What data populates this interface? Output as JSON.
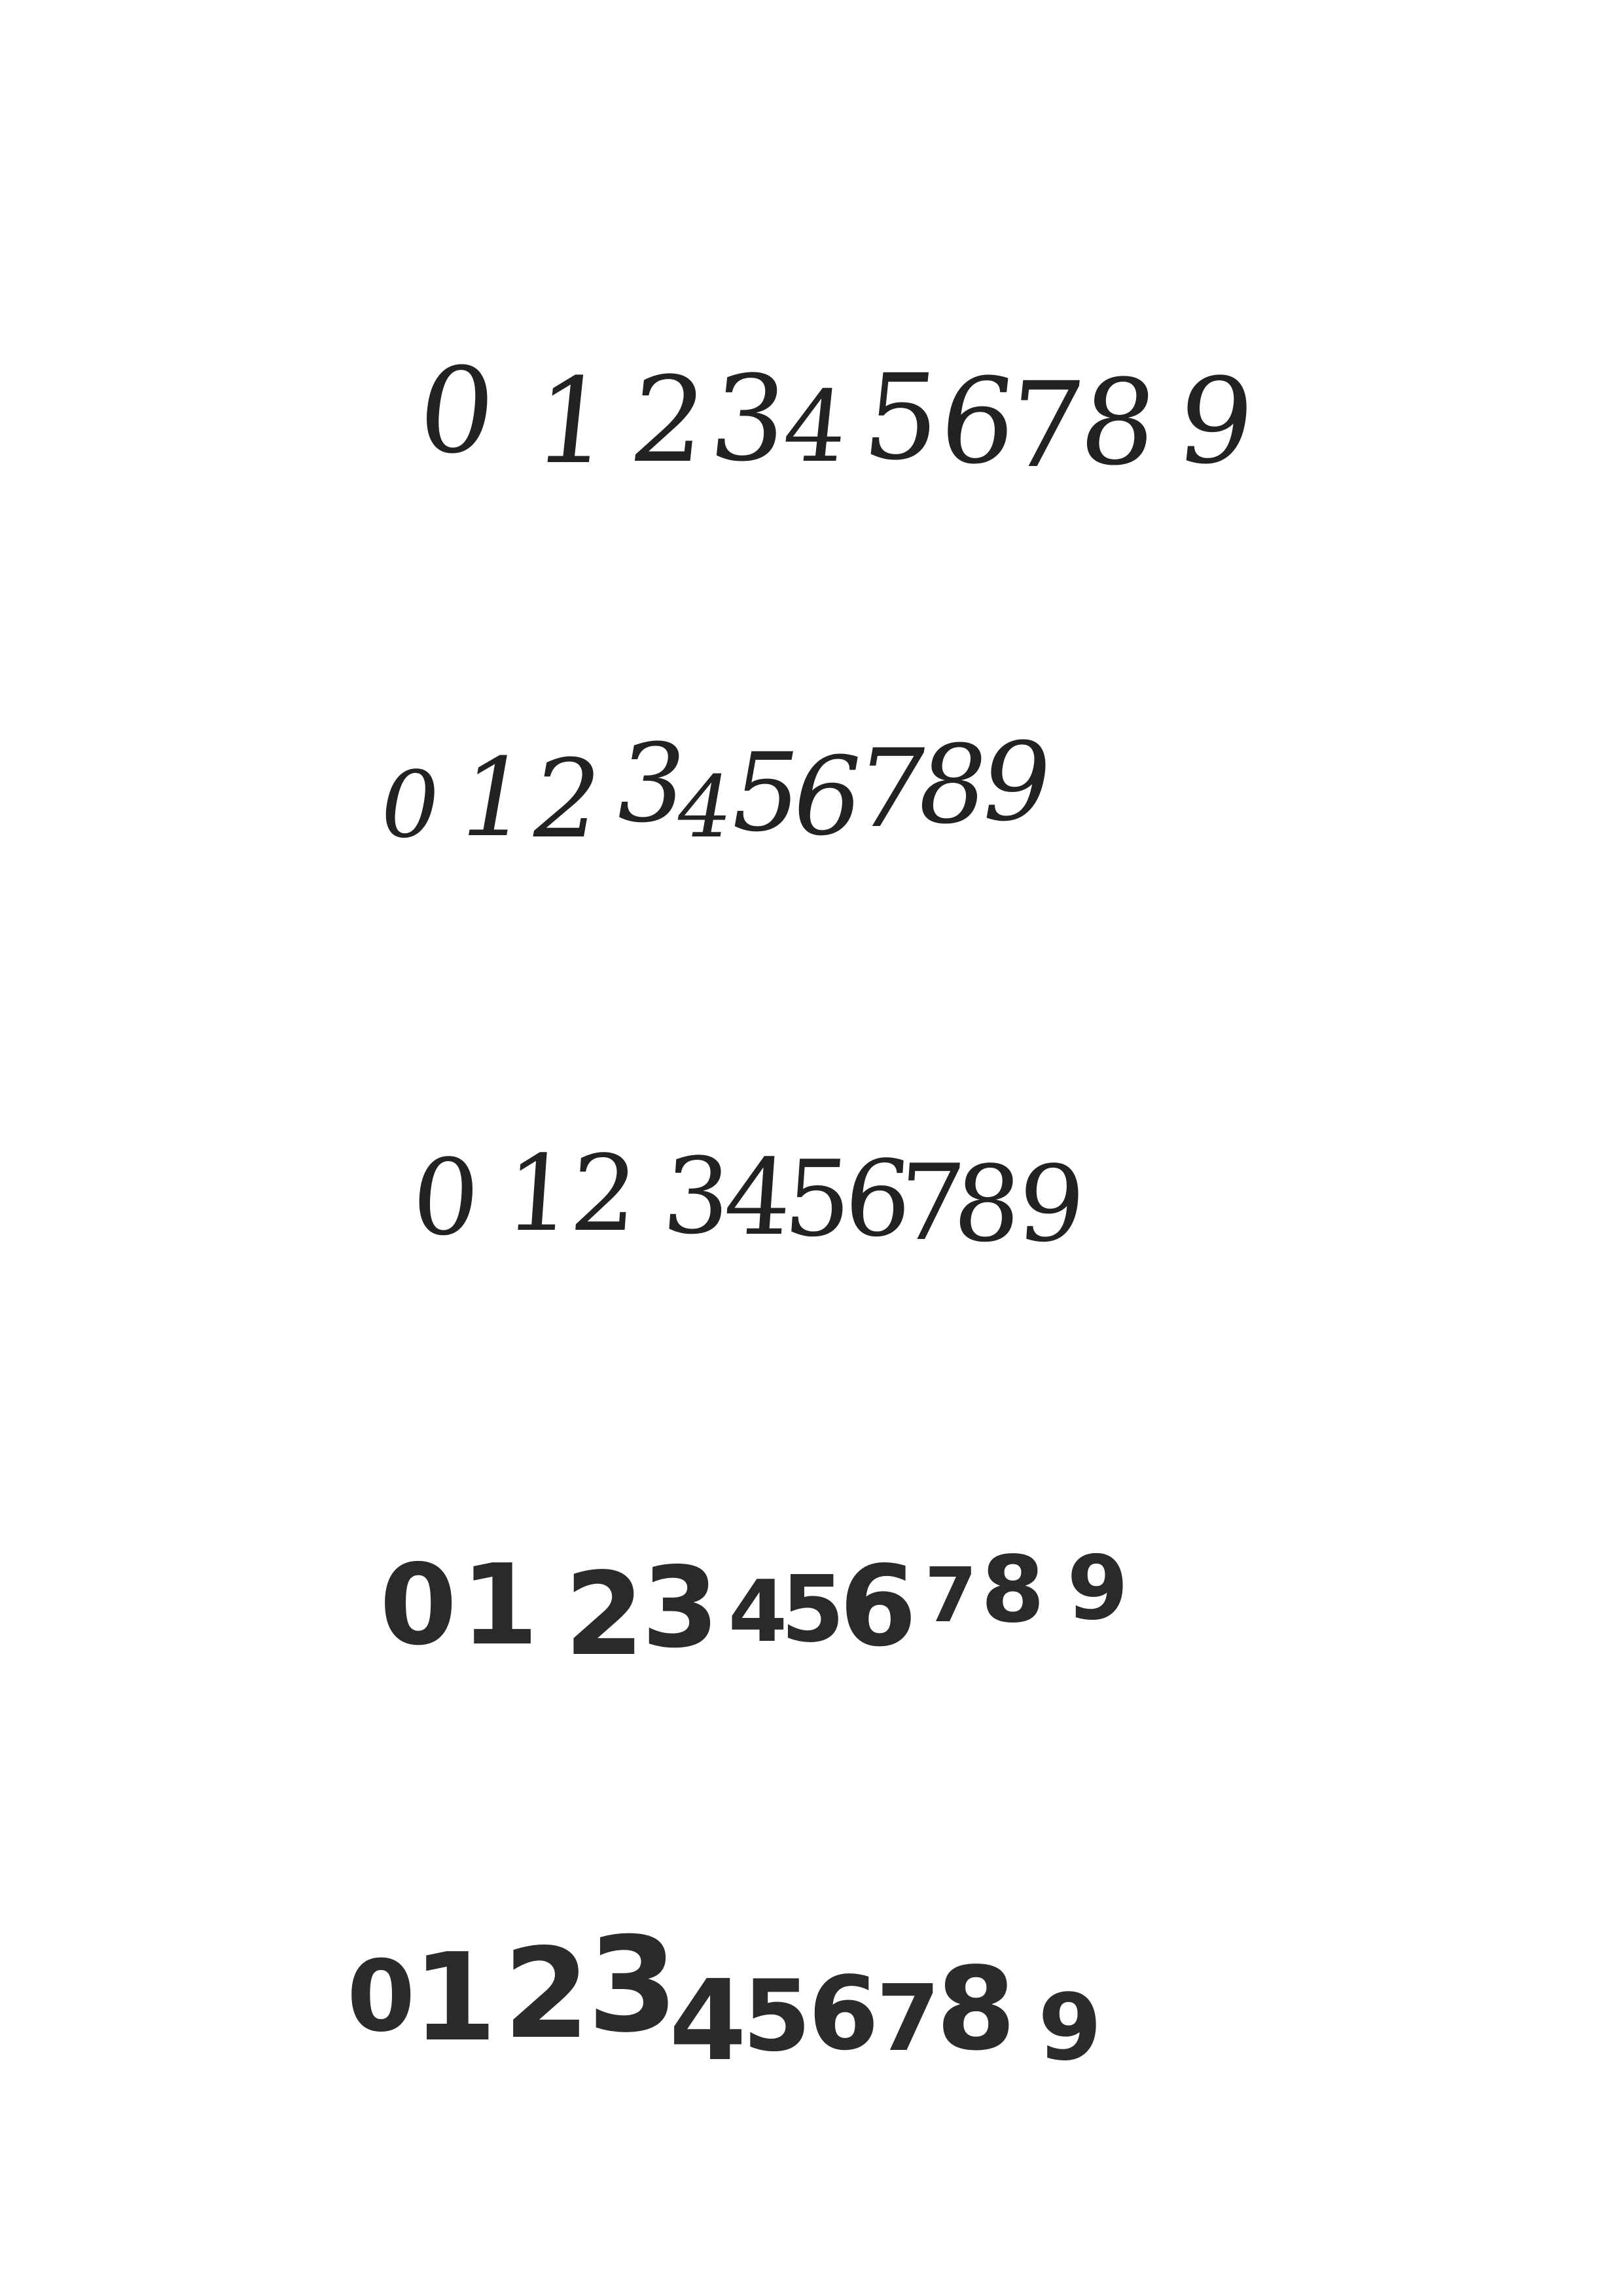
{
  "rows": [
    {
      "digits": [
        "0",
        "1",
        "2",
        "3",
        "4",
        "5",
        "6",
        "7",
        "8",
        "9"
      ]
    },
    {
      "digits": [
        "0",
        "1",
        "2",
        "3",
        "4",
        "5",
        "6",
        "7",
        "8",
        "9"
      ]
    },
    {
      "digits": [
        "0",
        "1",
        "2",
        "3",
        "4",
        "5",
        "6",
        "7",
        "8",
        "9"
      ]
    },
    {
      "digits": [
        "0",
        "1",
        "2",
        "3",
        "4",
        "5",
        "6",
        "7",
        "8",
        "9"
      ]
    },
    {
      "digits": [
        "0",
        "1",
        "2",
        "3",
        "4",
        "5",
        "6",
        "7",
        "8",
        "9"
      ]
    }
  ]
}
